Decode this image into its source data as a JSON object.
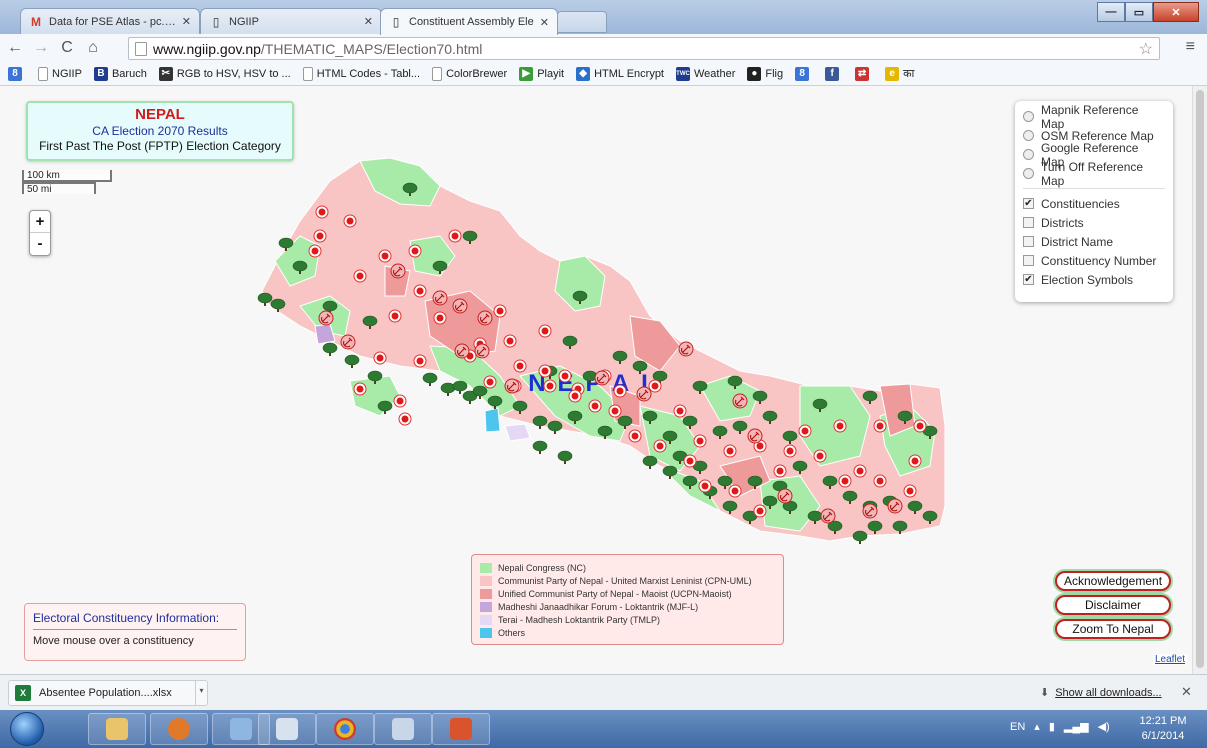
{
  "browser": {
    "tabs": [
      {
        "title": "Data for PSE Atlas - pc.ngi",
        "favicon": "gmail-icon"
      },
      {
        "title": "NGIIP",
        "favicon": "page-icon"
      },
      {
        "title": "Constituent Assembly Ele",
        "favicon": "page-icon",
        "active": true
      }
    ],
    "url_host": "www.ngiip.gov.np",
    "url_path": "/THEMATIC_MAPS/Election70.html",
    "bookmarks": [
      {
        "label": "",
        "icon": "google-plus-icon",
        "color": "#3b73d6"
      },
      {
        "label": "NGIIP",
        "icon": "page-icon",
        "color": "#ffffff"
      },
      {
        "label": "Baruch",
        "icon": "b-icon",
        "color": "#1f3c8f"
      },
      {
        "label": "RGB to HSV, HSV to ...",
        "icon": "scissors-icon",
        "color": "#333333"
      },
      {
        "label": "HTML Codes - Tabl...",
        "icon": "page-icon",
        "color": "#ffffff"
      },
      {
        "label": "ColorBrewer",
        "icon": "page-icon",
        "color": "#ffffff"
      },
      {
        "label": "Playit",
        "icon": "playit-icon",
        "color": "#3c9c3c"
      },
      {
        "label": "HTML Encrypt",
        "icon": "encrypt-icon",
        "color": "#2a6fc9"
      },
      {
        "label": "Weather",
        "icon": "twc-icon",
        "color": "#1f3c8f"
      },
      {
        "label": "Flig",
        "icon": "flig-icon",
        "color": "#222222"
      },
      {
        "label": "",
        "icon": "google-plus-icon",
        "color": "#3b73d6"
      },
      {
        "label": "",
        "icon": "facebook-icon",
        "color": "#3b5998"
      },
      {
        "label": "",
        "icon": "translate-icon",
        "color": "#cc3333"
      },
      {
        "label": "का",
        "icon": "devanagari-icon",
        "color": "#e5b700"
      }
    ]
  },
  "map": {
    "title": "NEPAL",
    "subtitle": "CA Election 2070 Results",
    "category": "First Past The Post (FPTP) Election Category",
    "scale_km": "100 km",
    "scale_mi": "50 mi",
    "zoom_in": "+",
    "zoom_out": "-",
    "map_label": "NEPAL",
    "layer_control": {
      "base_layers": [
        {
          "label": "Mapnik Reference Map"
        },
        {
          "label": "OSM Reference Map"
        },
        {
          "label": "Google Reference Map"
        },
        {
          "label": "Turn Off Reference Map"
        }
      ],
      "overlays": [
        {
          "label": "Constituencies",
          "checked": true
        },
        {
          "label": "Districts",
          "checked": false
        },
        {
          "label": "District Name",
          "checked": false
        },
        {
          "label": "Constituency Number",
          "checked": false
        },
        {
          "label": "Election Symbols",
          "checked": true
        }
      ]
    },
    "legend": [
      {
        "label": "Nepali Congress (NC)",
        "color": "#a8eba8"
      },
      {
        "label": "Communist Party of Nepal - United Marxist Leninist (CPN-UML)",
        "color": "#f8c4c4"
      },
      {
        "label": "Unified Communist Party of Nepal - Maoist (UCPN-Maoist)",
        "color": "#ef9a9a"
      },
      {
        "label": "Madheshi Janaadhikar Forum - Loktantrik (MJF-L)",
        "color": "#c4a6dc"
      },
      {
        "label": "Terai - Madhesh Loktantrik Party (TMLP)",
        "color": "#e4d8f6"
      },
      {
        "label": "Others",
        "color": "#4dc6ee"
      }
    ],
    "info_box": {
      "title": "Electoral Constituency Information:",
      "hint": "Move mouse over a constituency"
    },
    "buttons": {
      "acknowledgement": "Acknowledgement",
      "disclaimer": "Disclaimer",
      "zoom": "Zoom To Nepal"
    },
    "attribution": "Leaflet"
  },
  "downloads": {
    "file": "Absentee Population....xlsx",
    "show_all": "Show all downloads..."
  },
  "taskbar": {
    "lang": "EN",
    "time": "12:21 PM",
    "date": "6/1/2014"
  }
}
